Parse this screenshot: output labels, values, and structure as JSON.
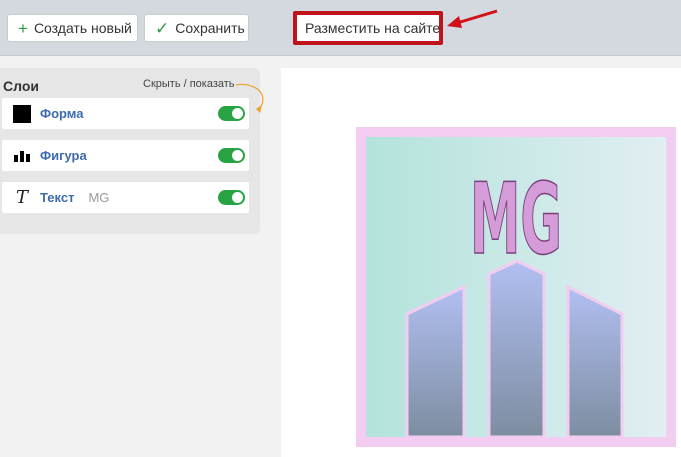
{
  "toolbar": {
    "create_label": "Создать новый",
    "create_icon": "plus-icon",
    "save_label": "Сохранить",
    "save_icon": "check-icon",
    "publish_label": "Разместить на сайте",
    "accent_color": "#2e9b3f",
    "highlight_color": "#c1131a"
  },
  "layers": {
    "title": "Слои",
    "hide_show_label": "Скрыть / показать",
    "items": [
      {
        "name": "Форма",
        "sub": "",
        "icon": "square-icon",
        "visible": true
      },
      {
        "name": "Фигура",
        "sub": "",
        "icon": "buildings-icon",
        "visible": true
      },
      {
        "name": "Текст",
        "sub": "MG",
        "icon": "text-icon",
        "visible": true
      }
    ]
  },
  "canvas": {
    "logo_text": "MG",
    "colors": {
      "border": "#f3cdf1",
      "background": "#bfe6e2",
      "text": "#d49cd8",
      "figure": "#8594af"
    }
  }
}
